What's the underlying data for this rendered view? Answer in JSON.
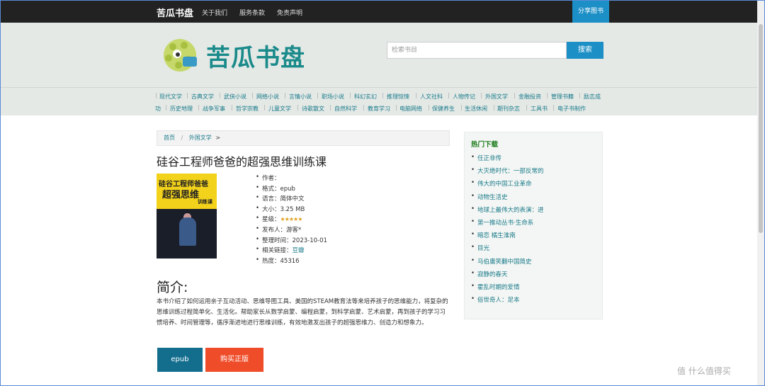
{
  "nav": {
    "brand": "苦瓜书盘",
    "links": [
      "关于我们",
      "服务条款",
      "免责声明"
    ],
    "share": "分享图书"
  },
  "header": {
    "logo_text": "苦瓜书盘",
    "search_placeholder": "检索书目",
    "search_button": "搜索"
  },
  "categories_row1": [
    "现代文学",
    "古典文学",
    "武侠小说",
    "网络小说",
    "言情小说",
    "职场小说",
    "科幻玄幻",
    "推理惊悚",
    "人文社科",
    "人物传记",
    "外国文学",
    "金融投资",
    "管理书籍",
    "励志成"
  ],
  "categories_row2": [
    "功",
    "历史地理",
    "战争军事",
    "哲学宗教",
    "儿童文学",
    "诗歌散文",
    "自然科学",
    "教育学习",
    "电脑网络",
    "保健养生",
    "生活休闲",
    "期刊杂志",
    "工具书",
    "电子书制作"
  ],
  "breadcrumb": {
    "home": "首页",
    "sep": "/",
    "category": "外国文学",
    "tail": ">"
  },
  "book": {
    "title": "硅谷工程师爸爸的超强思维训练课",
    "cover": {
      "line1": "硅谷工程师爸爸",
      "line2": "超强思维",
      "line3": "训练课"
    },
    "info": {
      "author": "作者：",
      "format": "格式：epub",
      "language": "语言：简体中文",
      "size": "大小：3.25 MB",
      "rating_label": "星级：",
      "rating_stars": "★★★★★",
      "rating_value": 5,
      "uploader": "发布人：游客*",
      "time": "整理时间：2023-10-01",
      "link_label": "相关链接：",
      "link_text": "豆瓣",
      "hot": "热度：45316"
    }
  },
  "intro": {
    "heading": "简介:",
    "text": "本书介绍了如何运用亲子互动活动、思维导图工具、美国的STEAM教育法等来培养孩子的思维能力，将复杂的思维训练过程简单化、生活化。帮助家长从数学启蒙、编程启蒙，到科学启蒙、艺术启蒙，再到孩子的学习习惯培养、时间管理等，循序渐进地进行思维训练，有效地激发出孩子的超强思维力、创造力和想象力。"
  },
  "buttons": {
    "epub": "epub",
    "buy": "购买正版"
  },
  "sidebar": {
    "heading": "热门下载",
    "items": [
      "任正非传",
      "大灭绝时代：一部反常的",
      "伟大的中国工业革命",
      "动物生活史",
      "地球上最伟大的表演：进",
      "第一推动丛书·生命系",
      "暗恋 橘生淮南",
      "目光",
      "马伯庸笑翻中国简史",
      "寂静的春天",
      "霍乱时期的爱情",
      "俗世奇人：足本"
    ]
  },
  "watermark": "值 什么值得买"
}
